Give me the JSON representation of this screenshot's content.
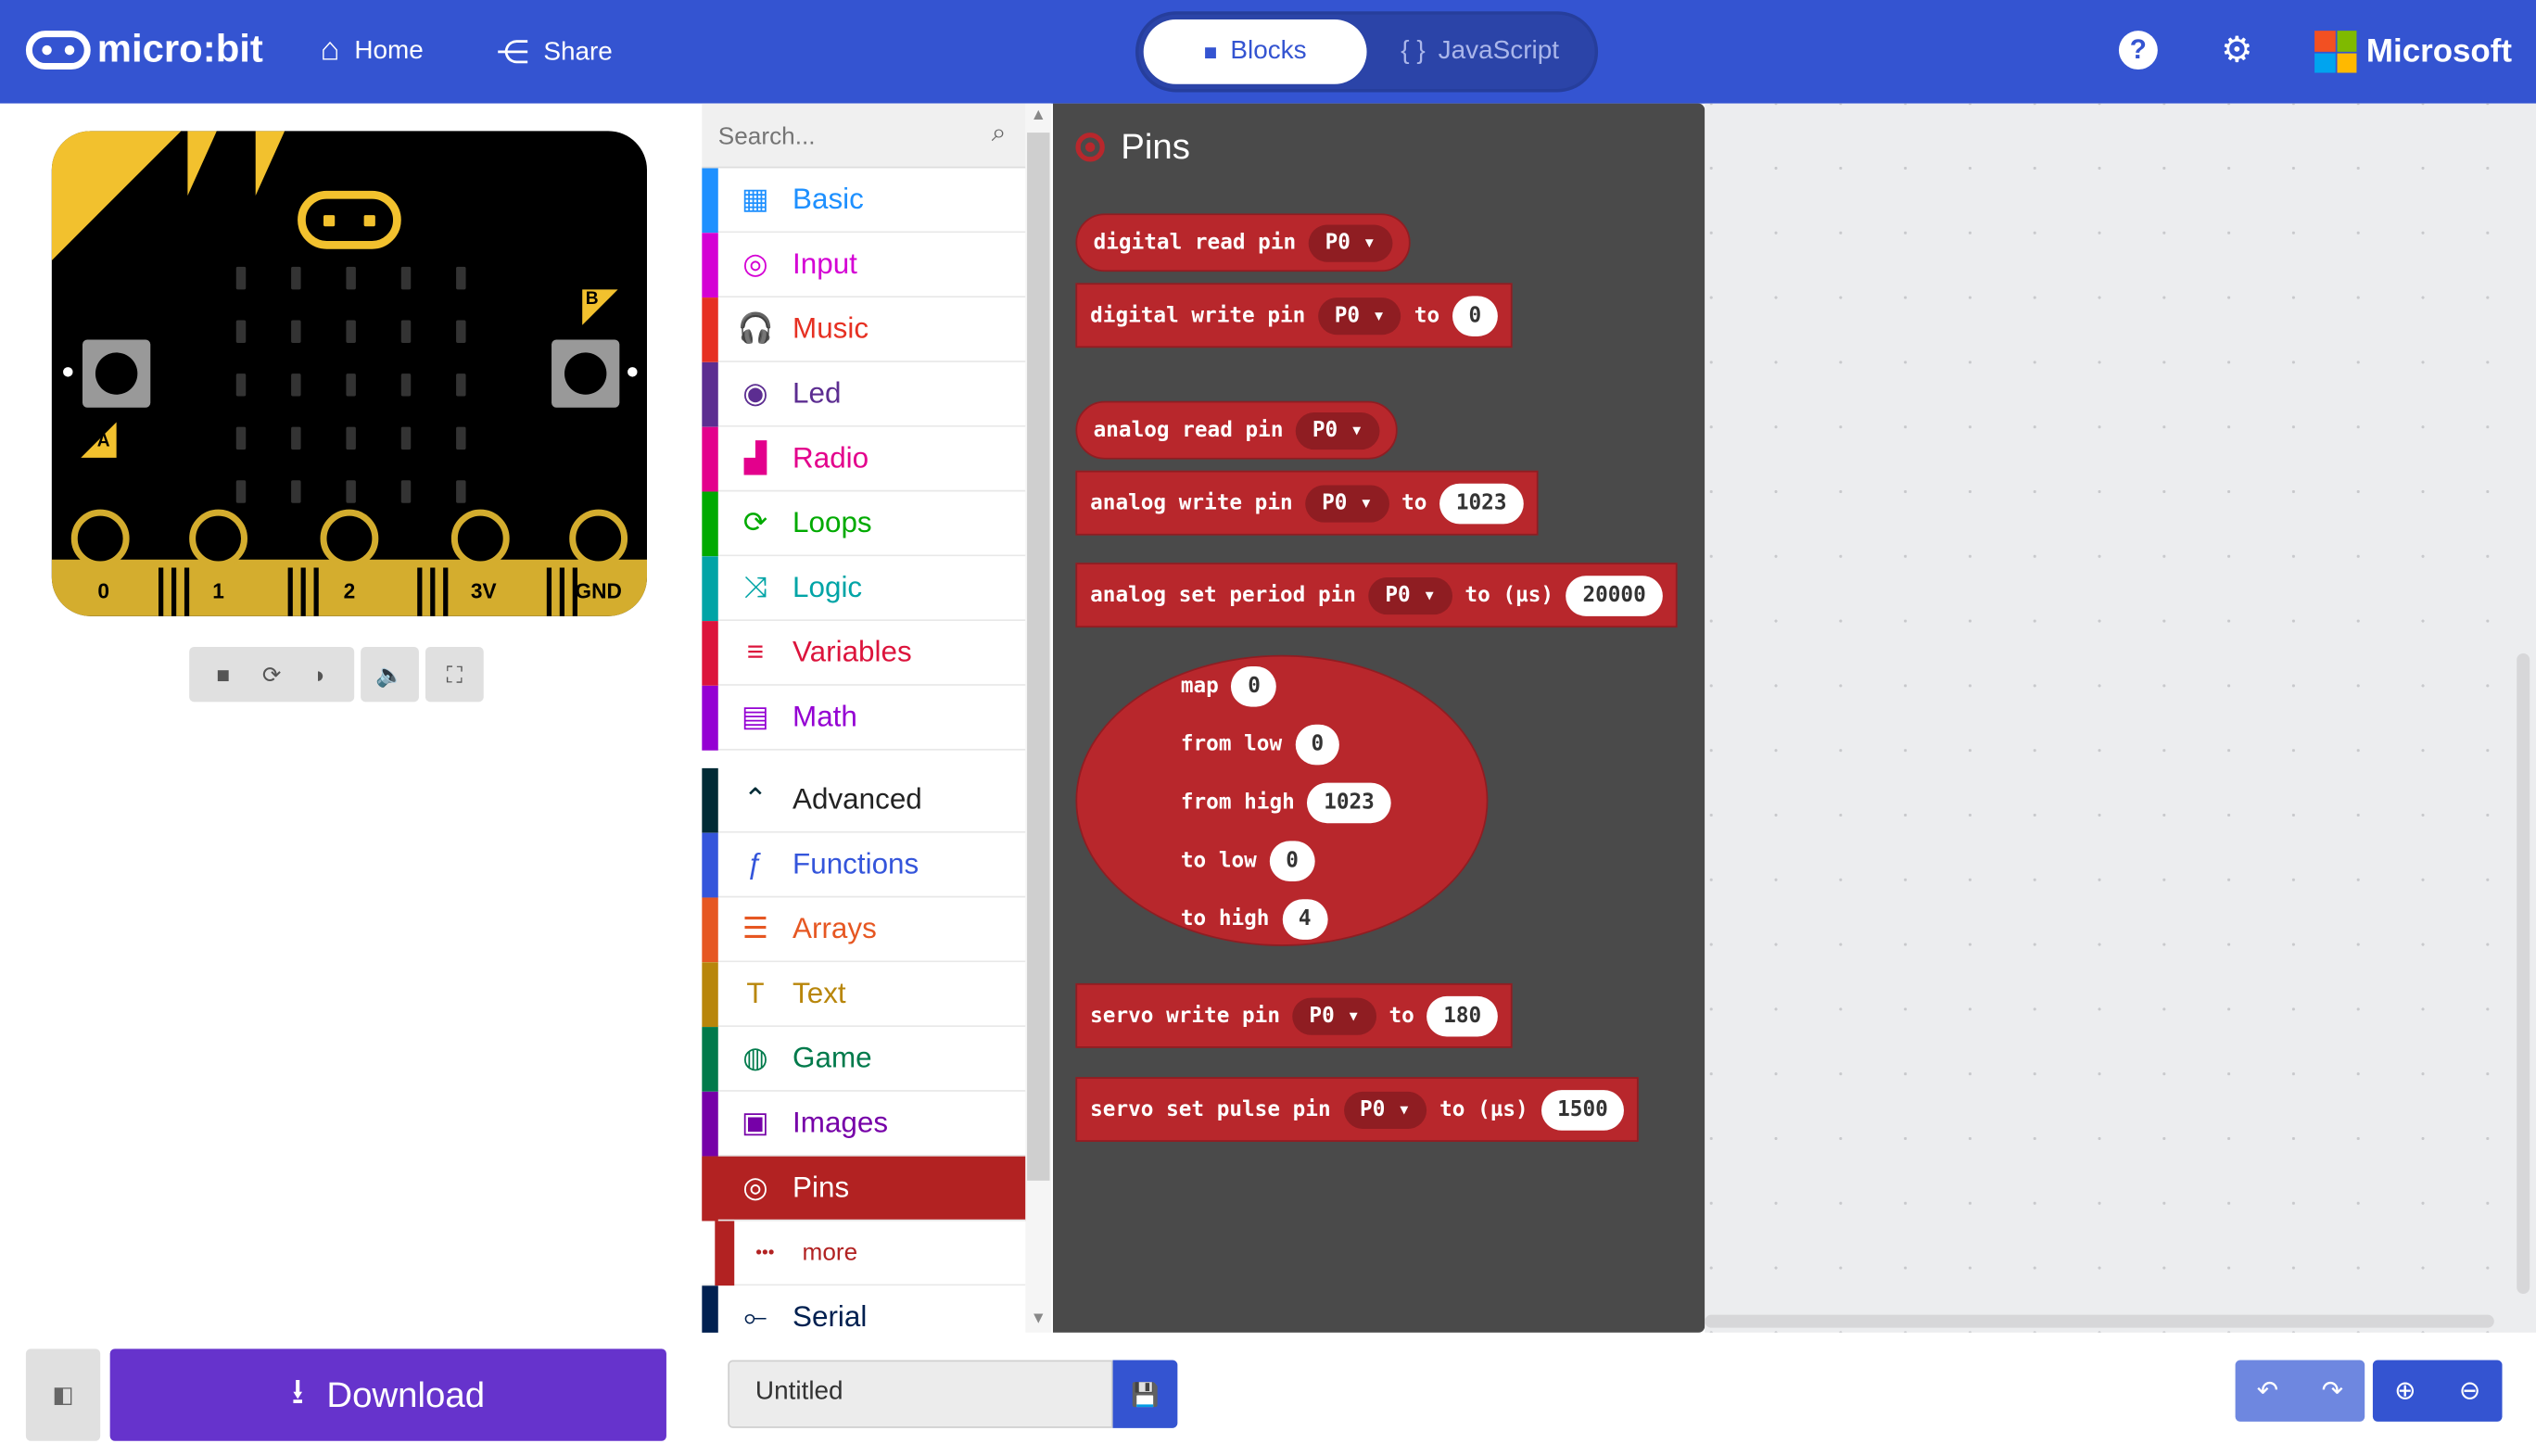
{
  "header": {
    "brand": "micro:bit",
    "home_label": "Home",
    "share_label": "Share",
    "blocks_label": "Blocks",
    "javascript_label": "JavaScript",
    "microsoft_label": "Microsoft"
  },
  "simulator": {
    "pins": [
      "0",
      "1",
      "2",
      "3V",
      "GND"
    ],
    "button_a": "A",
    "button_b": "B"
  },
  "toolbox": {
    "search_placeholder": "Search...",
    "categories": [
      {
        "label": "Basic",
        "color": "#1e90ff",
        "icon": "grid-icon"
      },
      {
        "label": "Input",
        "color": "#d400d4",
        "icon": "target-icon"
      },
      {
        "label": "Music",
        "color": "#e63022",
        "icon": "headphones-icon"
      },
      {
        "label": "Led",
        "color": "#5c2d91",
        "icon": "toggle-icon"
      },
      {
        "label": "Radio",
        "color": "#e3008c",
        "icon": "signal-icon"
      },
      {
        "label": "Loops",
        "color": "#00aa00",
        "icon": "refresh-icon"
      },
      {
        "label": "Logic",
        "color": "#00a4a6",
        "icon": "shuffle-icon"
      },
      {
        "label": "Variables",
        "color": "#dc143c",
        "icon": "list-icon"
      },
      {
        "label": "Math",
        "color": "#9400d3",
        "icon": "calculator-icon"
      },
      {
        "label": "Advanced",
        "color": "#002b36",
        "icon": "chevron-up-icon"
      },
      {
        "label": "Functions",
        "color": "#3455db",
        "icon": "function-icon"
      },
      {
        "label": "Arrays",
        "color": "#e65722",
        "icon": "numbered-list-icon"
      },
      {
        "label": "Text",
        "color": "#b8860b",
        "icon": "text-icon"
      },
      {
        "label": "Game",
        "color": "#007a4b",
        "icon": "gamepad-icon"
      },
      {
        "label": "Images",
        "color": "#7600a8",
        "icon": "image-icon"
      },
      {
        "label": "Pins",
        "color": "#b22222",
        "icon": "pins-icon"
      },
      {
        "label": "more",
        "color": "#b22222",
        "icon": "dots-icon"
      },
      {
        "label": "Serial",
        "color": "#002050",
        "icon": "usb-icon"
      }
    ]
  },
  "flyout": {
    "title": "Pins",
    "blocks": {
      "digital_read": {
        "label": "digital read pin",
        "pin": "P0"
      },
      "digital_write": {
        "label": "digital write pin",
        "pin": "P0",
        "to": "to",
        "value": "0"
      },
      "analog_read": {
        "label": "analog read pin",
        "pin": "P0"
      },
      "analog_write": {
        "label": "analog write pin",
        "pin": "P0",
        "to": "to",
        "value": "1023"
      },
      "analog_period": {
        "label": "analog set period pin",
        "pin": "P0",
        "to": "to (µs)",
        "value": "20000"
      },
      "map": {
        "map": "map",
        "map_val": "0",
        "from_low": "from low",
        "from_low_val": "0",
        "from_high": "from high",
        "from_high_val": "1023",
        "to_low": "to low",
        "to_low_val": "0",
        "to_high": "to high",
        "to_high_val": "4"
      },
      "servo_write": {
        "label": "servo write pin",
        "pin": "P0",
        "to": "to",
        "value": "180"
      },
      "servo_pulse": {
        "label": "servo set pulse pin",
        "pin": "P0",
        "to": "to (µs)",
        "value": "1500"
      }
    }
  },
  "footer": {
    "download_label": "Download",
    "project_name": "Untitled"
  },
  "colors": {
    "header": "#3454d1",
    "pins_block": "#b8272c",
    "download": "#6633cc"
  }
}
